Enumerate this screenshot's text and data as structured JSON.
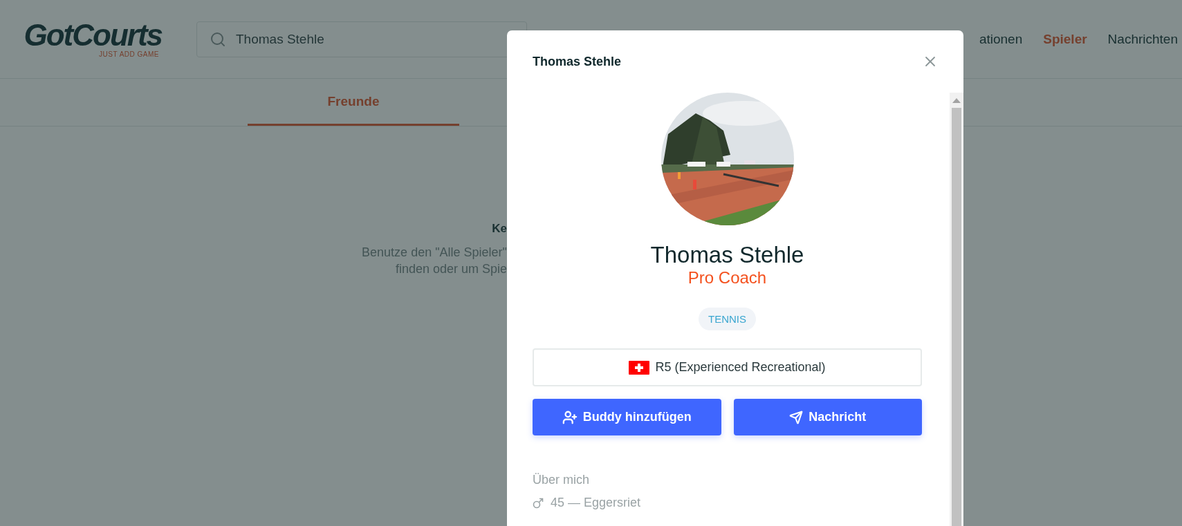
{
  "app": {
    "logo": {
      "name": "GotCourts",
      "tagline": "JUST ADD GAME"
    },
    "search": {
      "value": "Thomas Stehle"
    },
    "nav": [
      {
        "label": "ationen",
        "selected": false
      },
      {
        "label": "Spieler",
        "selected": true
      },
      {
        "label": "Nachrichten",
        "selected": false
      }
    ],
    "tabs": [
      {
        "label": "Freunde",
        "selected": true
      }
    ],
    "empty_state": {
      "title": "Ke",
      "lines": [
        "Benutze den \"Alle Spieler\"",
        "finden oder um Spie"
      ]
    }
  },
  "dialog": {
    "title": "Thomas Stehle",
    "profile": {
      "name": "Thomas Stehle",
      "role": "Pro Coach",
      "sport_tag": "TENNIS",
      "rating": "R5 (Experienced Recreational)",
      "buttons": [
        {
          "label": "Buddy hinzufügen",
          "kind": "add-friend"
        },
        {
          "label": "Nachricht",
          "kind": "message"
        }
      ],
      "about_heading": "Über mich",
      "details": "45 — Eggersriet"
    }
  }
}
